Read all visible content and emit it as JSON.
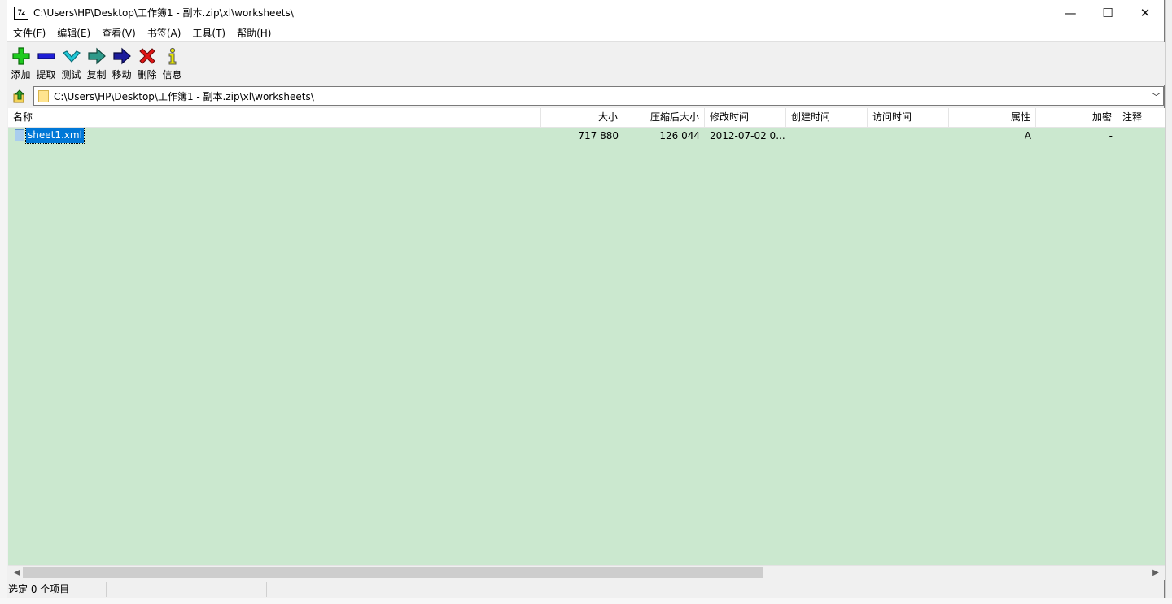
{
  "window": {
    "app_icon": "7z",
    "title": "C:\\Users\\HP\\Desktop\\工作簿1 - 副本.zip\\xl\\worksheets\\",
    "controls": {
      "minimize": "—",
      "maximize": "☐",
      "close": "✕"
    }
  },
  "menu": [
    {
      "label": "文件(F)"
    },
    {
      "label": "编辑(E)"
    },
    {
      "label": "查看(V)"
    },
    {
      "label": "书签(A)"
    },
    {
      "label": "工具(T)"
    },
    {
      "label": "帮助(H)"
    }
  ],
  "toolbar": [
    {
      "label": "添加",
      "icon": "add-plus-icon",
      "color": "#1ecb1e"
    },
    {
      "label": "提取",
      "icon": "extract-minus-icon",
      "color": "#1f1fd6"
    },
    {
      "label": "测试",
      "icon": "test-check-icon",
      "color": "#1fc8d8"
    },
    {
      "label": "复制",
      "icon": "copy-arrow-icon",
      "color": "#2e9a8a"
    },
    {
      "label": "移动",
      "icon": "move-arrow-icon",
      "color": "#1c1c9c"
    },
    {
      "label": "删除",
      "icon": "delete-x-icon",
      "color": "#e01515"
    },
    {
      "label": "信息",
      "icon": "info-icon",
      "color": "#e6e600"
    }
  ],
  "address": {
    "path": "C:\\Users\\HP\\Desktop\\工作簿1 - 副本.zip\\xl\\worksheets\\"
  },
  "columns": [
    "名称",
    "大小",
    "压缩后大小",
    "修改时间",
    "创建时间",
    "访问时间",
    "属性",
    "加密",
    "注释"
  ],
  "files": [
    {
      "name": "sheet1.xml",
      "size": "717 880",
      "packed": "126 044",
      "modified": "2012-07-02 0...",
      "created": "",
      "accessed": "",
      "attributes": "A",
      "encrypted": "-",
      "comment": ""
    }
  ],
  "status": {
    "selection": "选定 0 个项目"
  },
  "colors": {
    "list_background": "#cbe8cf",
    "selection": "#0078d7"
  }
}
